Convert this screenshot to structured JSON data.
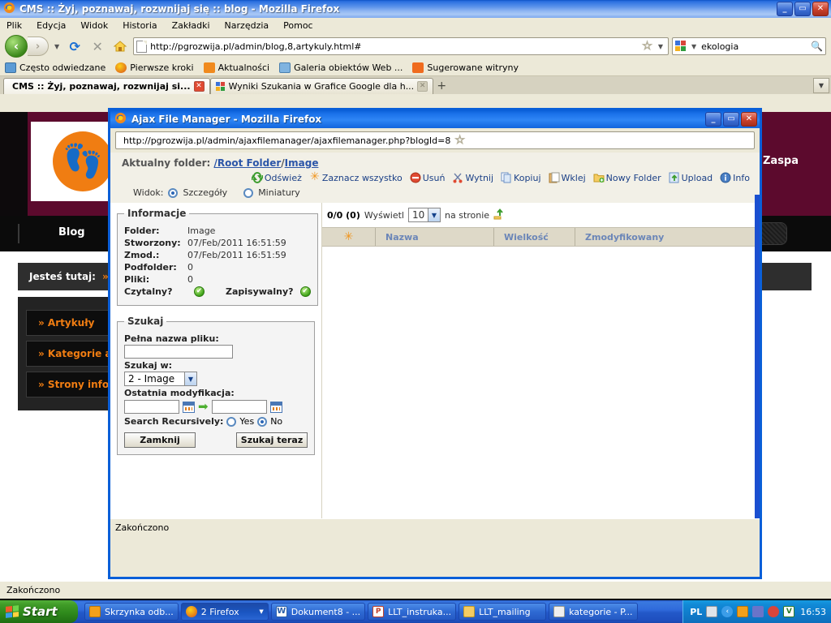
{
  "browser": {
    "title": "CMS :: Żyj, poznawaj, rozwnijaj się :: blog - Mozilla Firefox",
    "menu": [
      "Plik",
      "Edycja",
      "Widok",
      "Historia",
      "Zakładki",
      "Narzędzia",
      "Pomoc"
    ],
    "url": "http://pgrozwija.pl/admin/blog,8,artykuly.html#",
    "search_value": "ekologia",
    "bookmarks": [
      "Często odwiedzane",
      "Pierwsze kroki",
      "Aktualności",
      "Galeria obiektów Web ...",
      "Sugerowane witryny"
    ],
    "tabs": [
      {
        "label": "CMS :: Żyj, poznawaj, rozwnijaj si...",
        "active": true
      },
      {
        "label": "Wyniki Szukania w Grafice Google dla h...",
        "active": false
      }
    ],
    "new_tab_label": "+",
    "status": "Zakończono",
    "win_minimize": "_",
    "win_maximize": "▭",
    "win_close": "✕"
  },
  "site": {
    "brand_name": "Zaspa",
    "nav_label": "Blog",
    "breadcrumb_label": "Jesteś tutaj:",
    "breadcrumb_sep": "»",
    "menu_items": [
      "» Artykuły",
      "» Kategorie artykułów",
      "» Strony informacyjne"
    ]
  },
  "dialog": {
    "title": "Ajax File Manager - Mozilla Firefox",
    "url": "http://pgrozwija.pl/admin/ajaxfilemanager/ajaxfilemanager.php?blogId=8",
    "current_folder_label": "Aktualny folder:",
    "path_root": "/Root Folder",
    "path_sep": "/",
    "path_current": "Image",
    "toolbar": [
      {
        "label": "Odśwież",
        "icon": "refresh-icon"
      },
      {
        "label": "Zaznacz wszystko",
        "icon": "select-all-icon"
      },
      {
        "label": "Usuń",
        "icon": "delete-icon"
      },
      {
        "label": "Wytnij",
        "icon": "cut-icon"
      },
      {
        "label": "Kopiuj",
        "icon": "copy-icon"
      },
      {
        "label": "Wklej",
        "icon": "paste-icon"
      },
      {
        "label": "Nowy Folder",
        "icon": "new-folder-icon"
      },
      {
        "label": "Upload",
        "icon": "upload-icon"
      },
      {
        "label": "Info",
        "icon": "info-icon"
      }
    ],
    "view_label": "Widok:",
    "view_details": "Szczegóły",
    "view_thumbs": "Miniatury",
    "info": {
      "legend": "Informacje",
      "folder_key": "Folder:",
      "folder_val": "Image",
      "created_key": "Stworzony:",
      "created_val": "07/Feb/2011 16:51:59",
      "modified_key": "Zmod.:",
      "modified_val": "07/Feb/2011 16:51:59",
      "subfolders_key": "Podfolder:",
      "subfolders_val": "0",
      "files_key": "Pliki:",
      "files_val": "0",
      "readable_key": "Czytalny?",
      "writable_key": "Zapisywalny?",
      "check_mark": "✔"
    },
    "search": {
      "legend": "Szukaj",
      "filename_label": "Pełna nazwa pliku:",
      "filename_value": "",
      "searchin_label": "Szukaj w:",
      "searchin_value": "2 - Image",
      "modified_label": "Ostatnia modyfikacja:",
      "date_from": "",
      "date_to": "",
      "recursive_label": "Search Recursively:",
      "yes_label": "Yes",
      "no_label": "No",
      "close_button": "Zamknij",
      "search_button": "Szukaj teraz"
    },
    "list": {
      "counter": "0/0 (0)",
      "show_label": "Wyświetl",
      "per_page": "10",
      "per_page_suffix": "na stronie",
      "columns": [
        "",
        "Nazwa",
        "Wielkość",
        "Zmodyfikowany"
      ],
      "rows": []
    },
    "status": "Zakończono",
    "win_minimize": "_",
    "win_maximize": "▭",
    "win_close": "✕"
  },
  "taskbar": {
    "start_label": "Start",
    "items": [
      {
        "label": "Skrzynka odb...",
        "active": false
      },
      {
        "label": "2 Firefox",
        "active": true,
        "has_arrow": true
      },
      {
        "label": "Dokument8 - ...",
        "active": false
      },
      {
        "label": "LLT_instruka...",
        "active": false
      },
      {
        "label": "LLT_mailing",
        "active": false
      },
      {
        "label": "kategorie - P...",
        "active": false
      }
    ],
    "language": "PL",
    "clock": "16:53"
  },
  "colors": {
    "accent_blue": "#0a5fd8",
    "link_blue": "#2b55a8",
    "header_text": "#6b86b8",
    "orange": "#f0951e",
    "site_maroon": "#5c0a2d",
    "site_orange": "#f07d12",
    "green_ok": "#3fa318"
  }
}
